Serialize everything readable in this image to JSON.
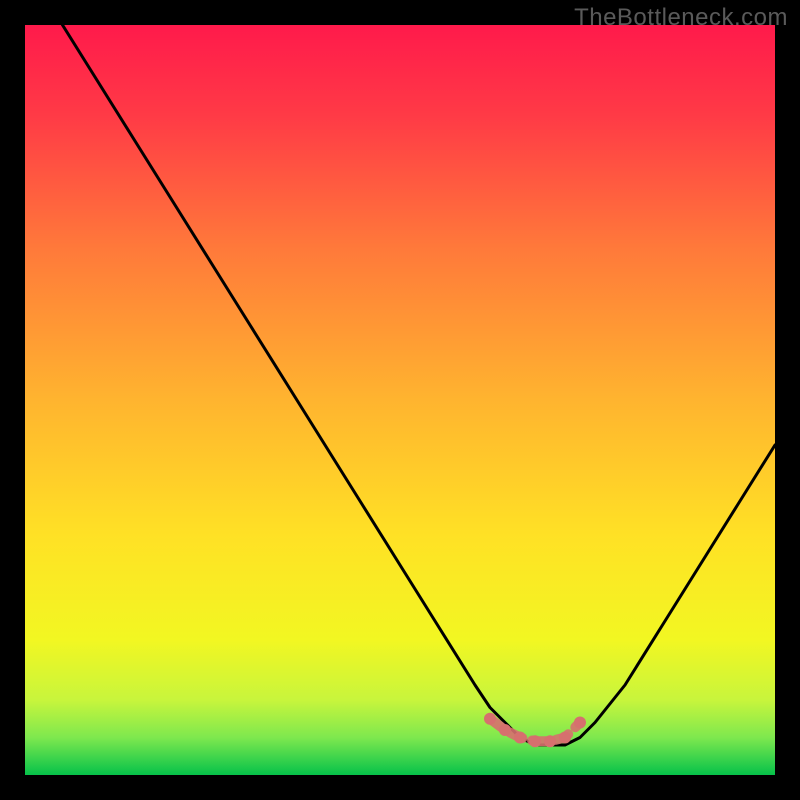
{
  "watermark": "TheBottleneck.com",
  "chart_data": {
    "type": "line",
    "title": "",
    "xlabel": "",
    "ylabel": "",
    "xlim": [
      0,
      100
    ],
    "ylim": [
      0,
      100
    ],
    "background": {
      "top_color": "#ff1a4b",
      "mid_color": "#ffd400",
      "bottom_color": "#06c24a",
      "note": "vertical gradient from red (top) through orange/yellow to green (bottom)"
    },
    "series": [
      {
        "name": "bottleneck-curve",
        "color": "#000000",
        "x": [
          5,
          10,
          15,
          20,
          25,
          30,
          35,
          40,
          45,
          50,
          55,
          60,
          62,
          64,
          66,
          68,
          70,
          72,
          74,
          76,
          80,
          85,
          90,
          95,
          100
        ],
        "y": [
          100,
          92,
          84,
          76,
          68,
          60,
          52,
          44,
          36,
          28,
          20,
          12,
          9,
          7,
          5,
          4,
          4,
          4,
          5,
          7,
          12,
          20,
          28,
          36,
          44
        ]
      },
      {
        "name": "highlight-dots",
        "color": "#d6706e",
        "type": "scatter",
        "x": [
          62,
          64,
          66,
          68,
          70,
          72,
          74
        ],
        "y": [
          7.5,
          6,
          5,
          4.5,
          4.5,
          5,
          7
        ]
      }
    ]
  }
}
